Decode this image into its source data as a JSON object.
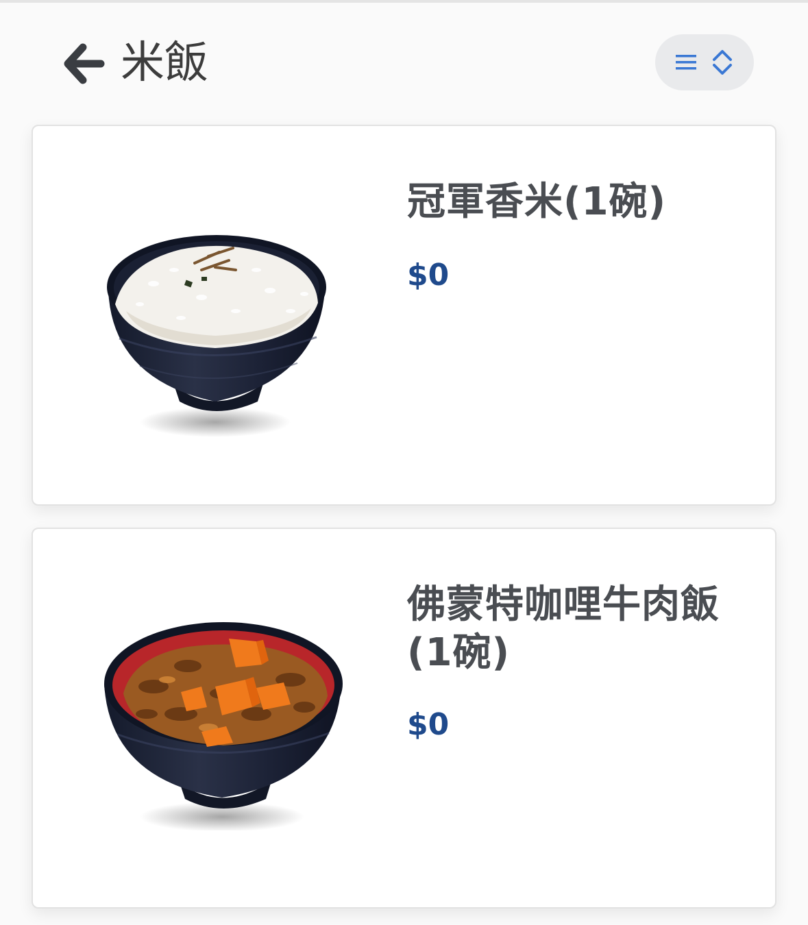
{
  "header": {
    "title": "米飯",
    "back_icon": "arrow-left-icon",
    "sort_icons": [
      "menu-lines-icon",
      "chevron-up-down-icon"
    ],
    "accent_color": "#3a78d4"
  },
  "menu_items": [
    {
      "name": "冠軍香米(1碗)",
      "price": "$0",
      "image": "white-rice-bowl"
    },
    {
      "name": "佛蒙特咖哩牛肉飯(1碗)",
      "price": "$0",
      "image": "curry-beef-rice-bowl"
    }
  ],
  "colors": {
    "price": "#1f4a8c",
    "title": "#3c3c3c",
    "item_name": "#4a4d52"
  }
}
